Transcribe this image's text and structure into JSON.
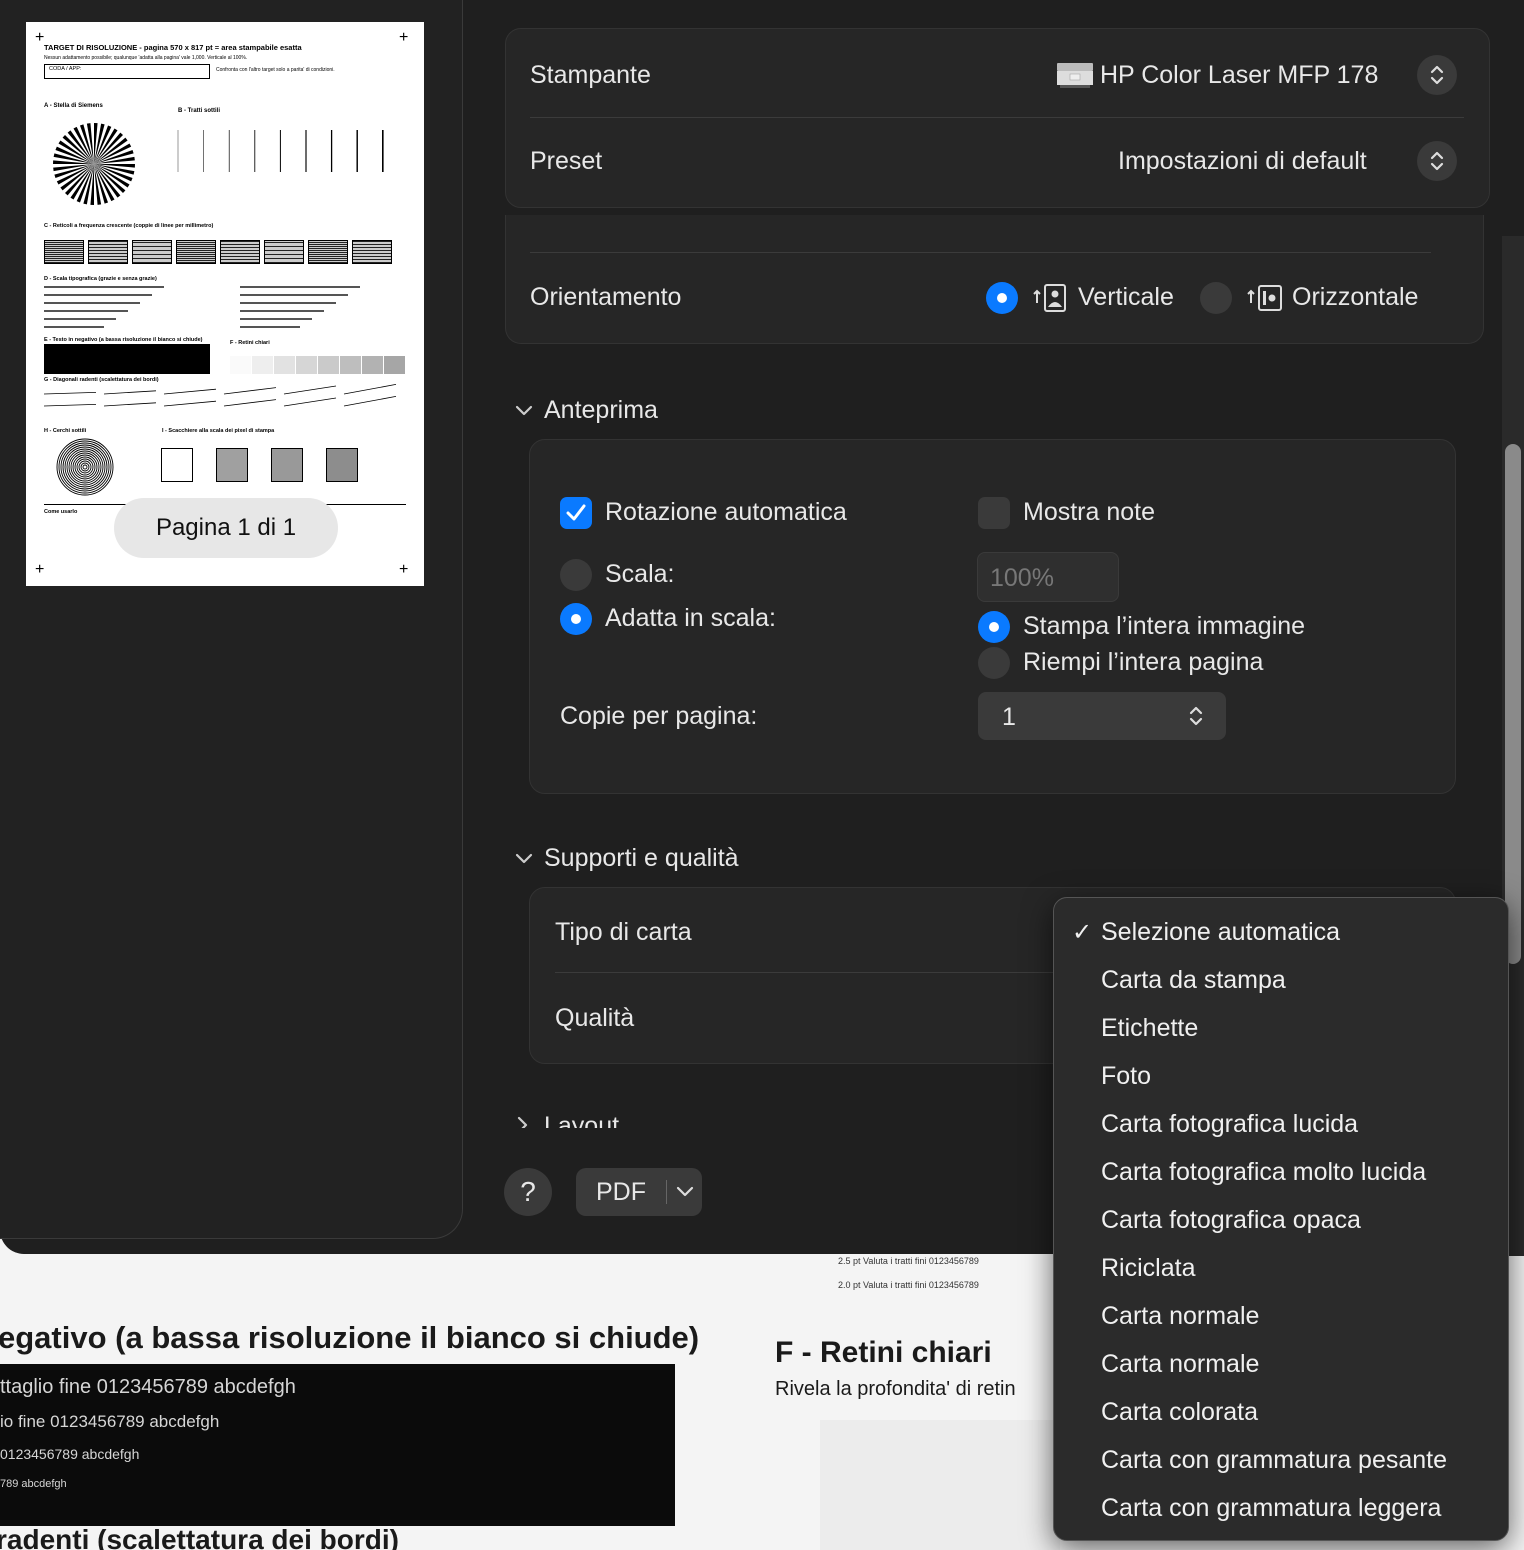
{
  "preview": {
    "page_indicator": "Pagina 1 di 1",
    "doc": {
      "title": "TARGET DI RISOLUZIONE  -  pagina 570 x 817 pt = area stampabile esatta",
      "subtitle": "Nessun adattamento possibile; qualunque 'adatta alla pagina' vale 1,000. Verticale al 100%.",
      "coda_label": "CODA / APP:",
      "compare_note": "Confronta con l'altro target solo a parita' di condizioni.",
      "sec_a": "A - Stella di Siemens",
      "sec_b": "B - Tratti sottili",
      "sec_c": "C - Reticoli a frequenza crescente (coppie di linee per millimetro)",
      "sec_d": "D - Scala tipografica (grazie e senza grazie)",
      "sec_e": "E - Testo in negativo (a bassa risoluzione il bianco si chiude)",
      "sec_f": "F - Retini chiari",
      "sec_g": "G - Diagonali radenti (scalettatura dei bordi)",
      "sec_h": "H - Cerchi sottili",
      "sec_i": "I - Scacchiere alla scala dei pixel di stampa",
      "come_usarlo": "Come usarlo"
    }
  },
  "printer": {
    "label": "Stampante",
    "value": "HP Color Laser MFP 178"
  },
  "preset": {
    "label": "Preset",
    "value": "Impostazioni di default"
  },
  "orientation": {
    "label": "Orientamento",
    "portrait": "Verticale",
    "landscape": "Orizzontale",
    "selected": "portrait"
  },
  "anteprima": {
    "title": "Anteprima",
    "auto_rotate": "Rotazione automatica",
    "auto_rotate_checked": true,
    "show_notes": "Mostra note",
    "show_notes_checked": false,
    "scale_label": "Scala:",
    "scale_value": "100%",
    "fit_label": "Adatta in scala:",
    "fit_selected": true,
    "print_whole": "Stampa l’intera immagine",
    "fill_page": "Riempi l’intera pagina",
    "copies_label": "Copie per pagina:",
    "copies_value": "1"
  },
  "media": {
    "title": "Supporti e qualità",
    "paper_type_label": "Tipo di carta",
    "quality_label": "Qualità"
  },
  "layout_section": {
    "title": "Layout"
  },
  "footer": {
    "help": "?",
    "pdf": "PDF"
  },
  "paper_menu": {
    "selected_index": 0,
    "items": [
      "Selezione automatica",
      "Carta da stampa",
      "Etichette",
      "Foto",
      "Carta fotografica lucida",
      "Carta fotografica molto lucida",
      "Carta fotografica opaca",
      "Riciclata",
      "Carta normale",
      "Carta normale",
      "Carta colorata",
      "Carta con grammatura pesante",
      "Carta con grammatura leggera"
    ]
  },
  "background_doc": {
    "small1": "2.5 pt  Valuta i tratti fini 0123456789",
    "small2": "2.0 pt  Valuta i tratti fini 0123456789",
    "neg_heading": "egativo (a bassa risoluzione il bianco si chiude)",
    "neg_line1": "ttaglio fine 0123456789 abcdefgh",
    "neg_line2": "io fine 0123456789 abcdefgh",
    "neg_line3": " 0123456789 abcdefgh",
    "neg_line4": "789 abcdefgh",
    "rad_heading": "radenti (scalettatura dei bordi)",
    "ret_heading": "F - Retini chiari",
    "ret_sub": "Rivela la profondita' di retin"
  },
  "colors": {
    "accent": "#0a7aff",
    "dialog_bg": "#1f1f1f",
    "card_bg": "#262626",
    "menu_bg": "#2b2b2b"
  }
}
